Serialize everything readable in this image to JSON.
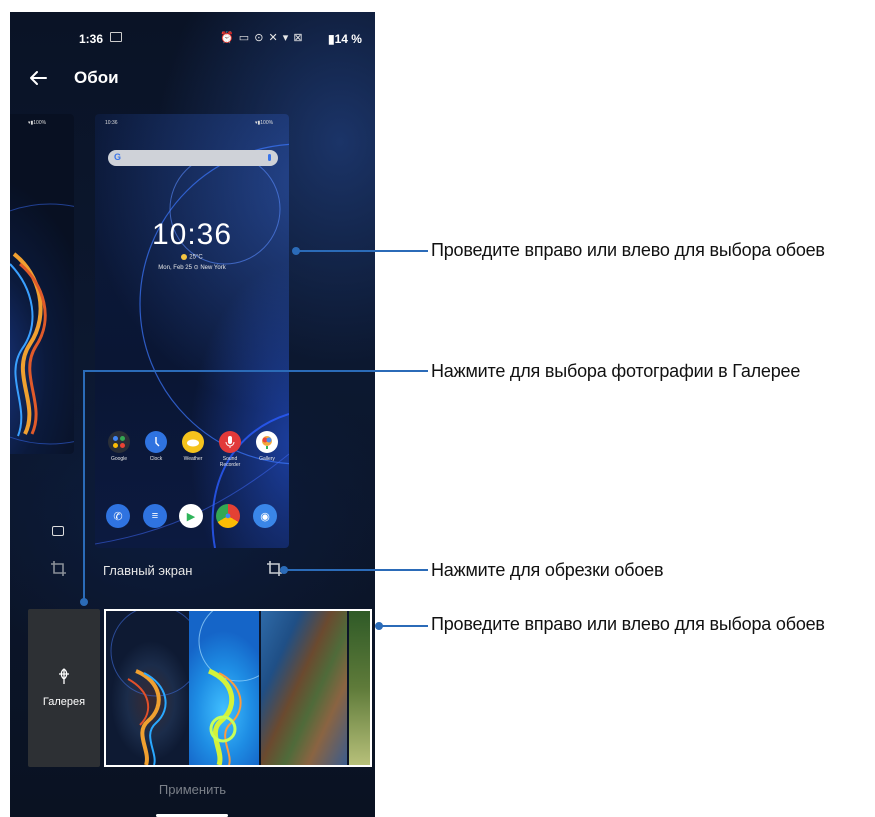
{
  "status_bar": {
    "time": "1:36",
    "icons_text": "⏰ ▭ ⊙ ✕ ▾ ⊠",
    "battery": "▮14 %"
  },
  "app_bar": {
    "title": "Обои",
    "back_icon": "arrow-left-icon"
  },
  "preview_main": {
    "mini_time": "10:36",
    "mini_battery": "▾▮100%",
    "search_logo": "G",
    "clock": "10:36",
    "temperature": "25°C",
    "date_location": "Mon, Feb 25  ⊙ New York",
    "apps": [
      {
        "label": "Google",
        "color": "#2a2f38"
      },
      {
        "label": "Clock",
        "color": "#2f73e0"
      },
      {
        "label": "Weather",
        "color": "#f5c31d"
      },
      {
        "label": "Sound Recorder",
        "color": "#e23a3a"
      },
      {
        "label": "Gallery",
        "color": "#ffffff"
      }
    ],
    "dock": [
      {
        "name": "phone",
        "color": "#2f73e0",
        "glyph": "✆"
      },
      {
        "name": "messages",
        "color": "#2f73e0",
        "glyph": "≡"
      },
      {
        "name": "play-store",
        "color": "#ffffff",
        "glyph": "▶"
      },
      {
        "name": "chrome",
        "color": "#e44134",
        "glyph": "●"
      },
      {
        "name": "camera",
        "color": "#3a86e8",
        "glyph": "◉"
      }
    ]
  },
  "preview_left": {
    "mini_battery": "▾▮100%"
  },
  "main_label": "Главный экран",
  "gallery_label": "Галерея",
  "apply_label": "Применить",
  "callouts": [
    "Проведите вправо или влево для выбора обоев",
    "Нажмите для выбора фотографии в Галерее",
    "Нажмите для обрезки обоев",
    "Проведите вправо или влево для выбора обоев"
  ],
  "colors": {
    "callout_line": "#2b6bb8",
    "background": "#0a1326",
    "accent_blue": "#2f73e0"
  }
}
